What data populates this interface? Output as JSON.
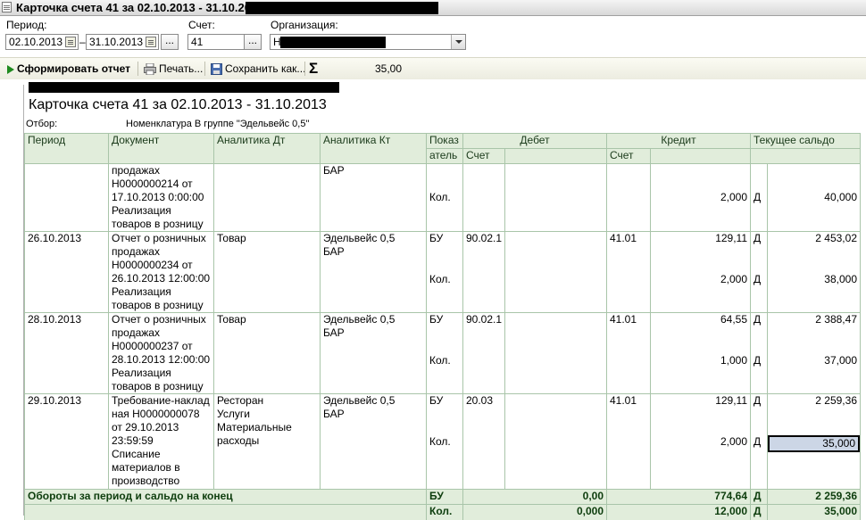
{
  "window": {
    "title": "Карточка счета 41 за 02.10.2013 - 31.10.20"
  },
  "params": {
    "period_label": "Период:",
    "date_from": "02.10.2013",
    "date_to": "31.10.2013",
    "dash": "–",
    "account_label": "Счет:",
    "account_value": "41",
    "org_label": "Организация:",
    "org_value": "Н",
    "dots": "..."
  },
  "toolbar": {
    "generate": "Сформировать отчет",
    "print": "Печать...",
    "save": "Сохранить как...",
    "sigma": "Σ",
    "sum": "35,00"
  },
  "report": {
    "title": "Карточка счета 41 за 02.10.2013 - 31.10.2013",
    "filter_label": "Отбор:",
    "filter_value": "Номенклатура В группе \"Эдельвейс 0,5\"",
    "headers": {
      "period": "Период",
      "document": "Документ",
      "an_dt": "Аналитика Дт",
      "an_kt": "Аналитика Кт",
      "indicator1": "Показ",
      "indicator2": "атель",
      "debit": "Дебет",
      "credit": "Кредит",
      "balance": "Текущее сальдо",
      "acc": "Счет"
    },
    "rows": [
      {
        "period": "",
        "doc": [
          "продажах",
          "Н0000000214 от",
          "17.10.2013 0:00:00",
          "Реализация",
          "товаров в розницу"
        ],
        "an_dt": [],
        "an_kt": [
          "БАР"
        ],
        "ind": [
          "Кол."
        ],
        "deb_acc": "",
        "deb_sum": [
          ""
        ],
        "cred_acc": "",
        "cred_sum": [
          "2,000"
        ],
        "bal_sign": [
          "Д"
        ],
        "bal": [
          "40,000"
        ]
      },
      {
        "period": "26.10.2013",
        "doc": [
          "Отчет о розничных",
          "продажах",
          "Н0000000234 от",
          "26.10.2013 12:00:00",
          "Реализация",
          "товаров в розницу"
        ],
        "an_dt": [
          "Товар"
        ],
        "an_kt": [
          "Эдельвейс 0,5",
          "БАР"
        ],
        "ind": [
          "БУ",
          "Кол."
        ],
        "deb_acc": "90.02.1",
        "deb_sum": [
          "",
          ""
        ],
        "cred_acc": "41.01",
        "cred_sum": [
          "129,11",
          "2,000"
        ],
        "bal_sign": [
          "Д",
          "Д"
        ],
        "bal": [
          "2 453,02",
          "38,000"
        ]
      },
      {
        "period": "28.10.2013",
        "doc": [
          "Отчет о розничных",
          "продажах",
          "Н0000000237 от",
          "28.10.2013 12:00:00",
          "Реализация",
          "товаров в розницу"
        ],
        "an_dt": [
          "Товар"
        ],
        "an_kt": [
          "Эдельвейс 0,5",
          "БАР"
        ],
        "ind": [
          "БУ",
          "Кол."
        ],
        "deb_acc": "90.02.1",
        "deb_sum": [
          "",
          ""
        ],
        "cred_acc": "41.01",
        "cred_sum": [
          "64,55",
          "1,000"
        ],
        "bal_sign": [
          "Д",
          "Д"
        ],
        "bal": [
          "2 388,47",
          "37,000"
        ]
      },
      {
        "period": "29.10.2013",
        "doc": [
          "Требование-наклад",
          "ная Н0000000078",
          "от 29.10.2013",
          "23:59:59",
          "Списание",
          "материалов в",
          "производство"
        ],
        "an_dt": [
          "Ресторан",
          "Услуги",
          "Материальные",
          "расходы"
        ],
        "an_kt": [
          "Эдельвейс 0,5",
          "БАР"
        ],
        "ind": [
          "БУ",
          "Кол."
        ],
        "deb_acc": "20.03",
        "deb_sum": [
          "",
          ""
        ],
        "cred_acc": "41.01",
        "cred_sum": [
          "129,11",
          "2,000"
        ],
        "bal_sign": [
          "Д",
          "Д"
        ],
        "bal": [
          "2 259,36",
          "35,000"
        ]
      }
    ],
    "footer": {
      "label": "Обороты за период и сальдо на конец",
      "ind": [
        "БУ",
        "Кол."
      ],
      "debit": [
        "0,00",
        "0,000"
      ],
      "credit": [
        "774,64",
        "12,000"
      ],
      "sign": [
        "Д",
        "Д"
      ],
      "balance": [
        "2 259,36",
        "35,000"
      ]
    }
  }
}
